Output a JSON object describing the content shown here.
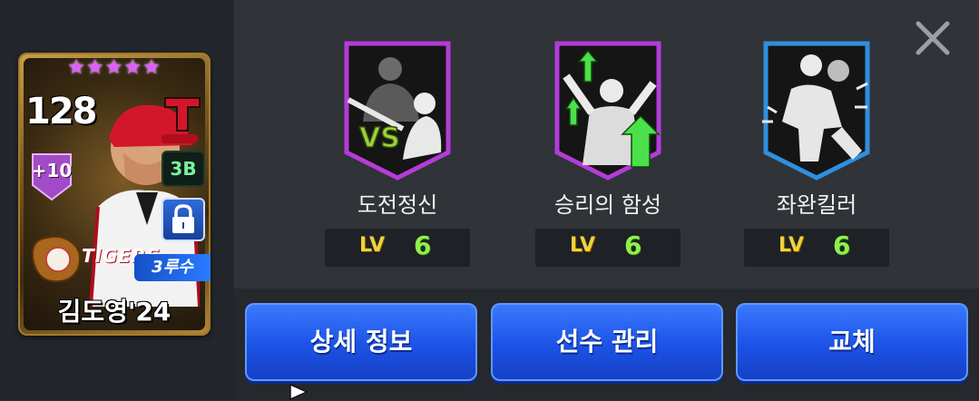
{
  "player_card": {
    "stars": "★★★★★",
    "overall": "128",
    "enhance": "+10",
    "position": "3B",
    "sub_position": "3루수",
    "team_name": "TIGERS",
    "name": "김도영'24",
    "card_color": "#caa14a",
    "star_color": "#e05cff"
  },
  "skills": [
    {
      "name": "도전정신",
      "lv_label": "LV",
      "lv_value": "6",
      "frame_color": "#b43cd8"
    },
    {
      "name": "승리의 함성",
      "lv_label": "LV",
      "lv_value": "6",
      "frame_color": "#b43cd8"
    },
    {
      "name": "좌완킬러",
      "lv_label": "LV",
      "lv_value": "6",
      "frame_color": "#2f8fe0"
    }
  ],
  "buttons": {
    "detail": "상세 정보",
    "manage": "선수 관리",
    "swap": "교체"
  },
  "colors": {
    "button_blue": "#1c52e6",
    "lv_yellow": "#f0d23c",
    "lv_green": "#8ef04e"
  }
}
